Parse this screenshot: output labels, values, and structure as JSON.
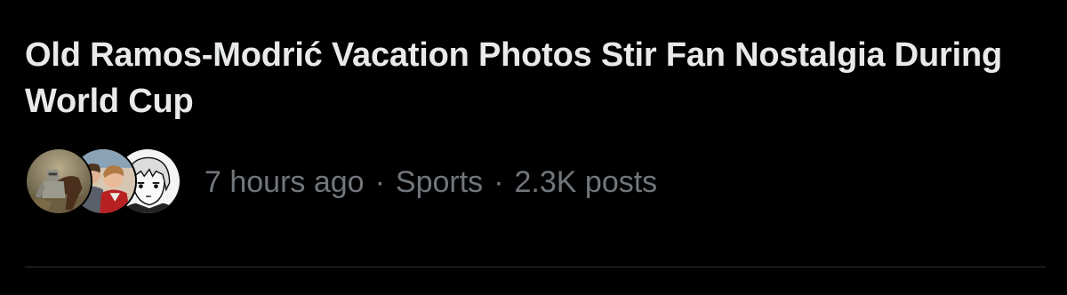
{
  "trend": {
    "headline": "Old Ramos-Modrić Vacation Photos Stir Fan Nostalgia During World Cup",
    "time": "7 hours ago",
    "separator": "·",
    "category": "Sports",
    "post_count": "2.3K posts"
  },
  "avatars": [
    {
      "icon": "knight-on-horse-avatar"
    },
    {
      "icon": "two-boys-photo-avatar"
    },
    {
      "icon": "anime-character-avatar"
    }
  ],
  "colors": {
    "background": "#000000",
    "headline_text": "#e7e9ea",
    "meta_text": "#71767b",
    "divider": "#2f3336"
  }
}
